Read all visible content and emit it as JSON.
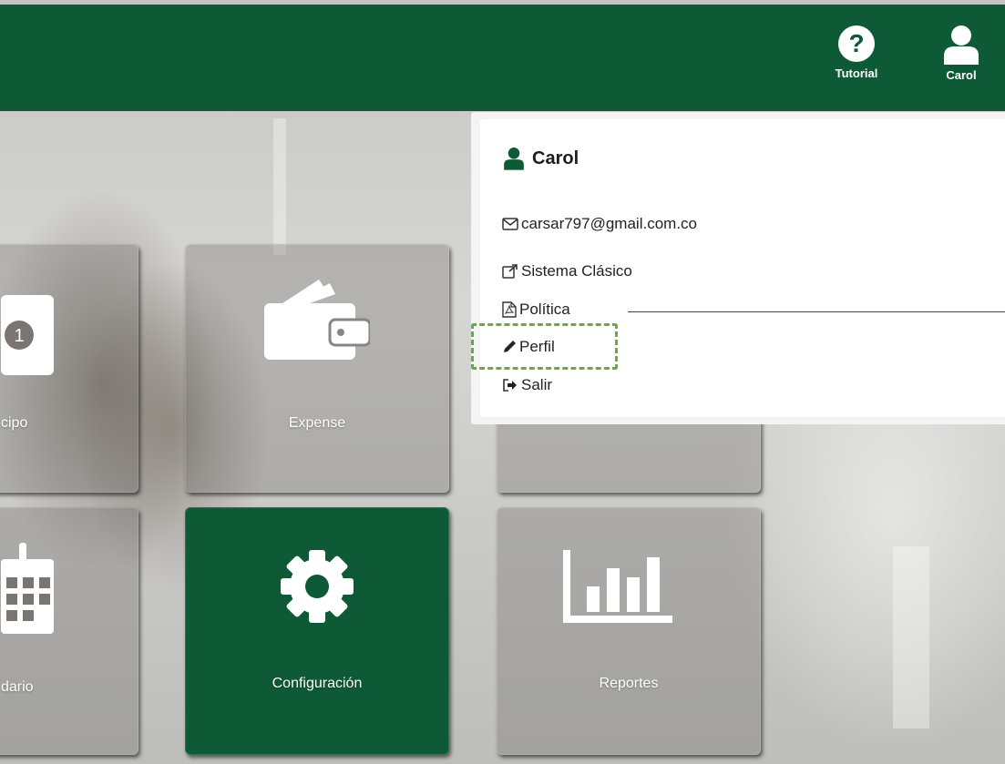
{
  "header": {
    "tutorial_label": "Tutorial",
    "user_label": "Carol"
  },
  "tiles": {
    "anticipo_label": "cipo",
    "expense_label": "Expense",
    "calendario_label": "dario",
    "configuracion_label": "Configuración",
    "reportes_label": "Reportes"
  },
  "user_menu": {
    "name": "Carol",
    "email": "carsar797@gmail.com.co",
    "sistema_clasico": "Sistema Clásico",
    "politica": "Política",
    "perfil": "Perfil",
    "salir": "Salir"
  },
  "colors": {
    "brand_green": "#0f5a36",
    "highlight_green": "#6aa946"
  },
  "icons": [
    "help-icon",
    "user-icon",
    "money-icon",
    "wallet-icon",
    "calendar-icon",
    "gear-icon",
    "bar-chart-icon",
    "envelope-icon",
    "external-link-icon",
    "pdf-icon",
    "pencil-icon",
    "sign-out-icon"
  ]
}
